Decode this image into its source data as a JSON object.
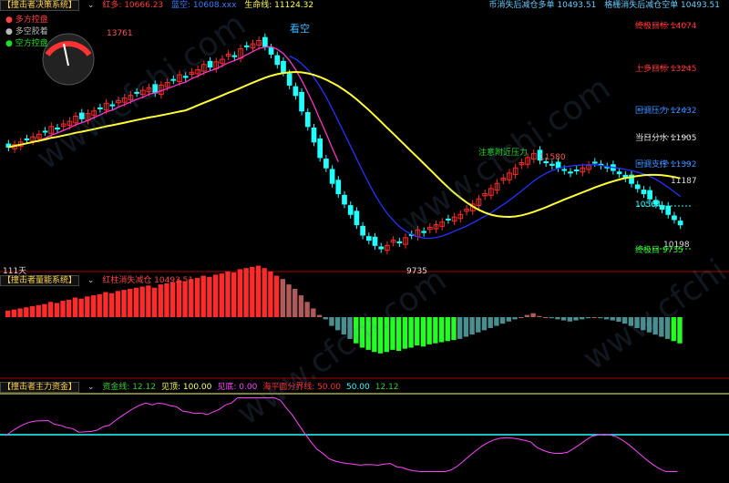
{
  "main_panel": {
    "title": "【撞击者决策系统】",
    "dropdown_icon": "chevron-down-icon",
    "indicators": [
      {
        "label": "红多",
        "value": "10666.23",
        "color": "#ff3b3b"
      },
      {
        "label": "蓝空",
        "value": "10608.xxx",
        "color": "#3b7dff"
      },
      {
        "label": "生命线",
        "value": "11124.32",
        "color": "#ffff55"
      }
    ],
    "top_right": [
      {
        "text": "币消失后减仓多单 10493.51",
        "color": "#66ccff"
      },
      {
        "text": "格栅消失后减仓空单 10493.51",
        "color": "#66ccff"
      }
    ],
    "legend": [
      {
        "text": "多方控盘",
        "color": "#ff4040"
      },
      {
        "text": "多空胶着",
        "color": "#bbbbbb"
      },
      {
        "text": "空方控盘",
        "color": "#22dd22"
      }
    ],
    "annotations": {
      "look_short": "看空",
      "near_resistance": "注意附近压力",
      "high_label": "13761",
      "low_label": "9735",
      "peak_label": "11580",
      "right_label": "11187",
      "last_low_label": "10198",
      "period": "111天"
    },
    "right_levels": [
      {
        "label": "终极目标",
        "value": "14074",
        "color": "#ff3333"
      },
      {
        "label": "上多目标",
        "value": "13245",
        "color": "#ff3333"
      },
      {
        "label": "回调压力",
        "value": "12432",
        "color": "#3a8cff"
      },
      {
        "label": "当日分水",
        "value": "11905",
        "color": "#dddddd"
      },
      {
        "label": "回调支撑",
        "value": "11392",
        "color": "#3a8cff"
      },
      {
        "label": "",
        "value": "10564",
        "color": "#22ffff"
      },
      {
        "label": "终极目",
        "value": "9735",
        "color": "#33ff33"
      }
    ]
  },
  "mid_panel": {
    "title": "【撞击者量能系统】",
    "indicator": "红柱消失减仓 10493.51",
    "indicator_color": "#ff4444"
  },
  "bottom_panel": {
    "title": "【撞击者主力资金】",
    "items": [
      {
        "label": "资金线",
        "value": "12.12",
        "color": "#33cc33"
      },
      {
        "label": "见顶",
        "value": "100.00",
        "color": "#ffff66"
      },
      {
        "label": "见底",
        "value": "0.00",
        "color": "#ff44ff"
      },
      {
        "label": "海平面分界线",
        "value": "50.00",
        "color": "#ff3333"
      },
      {
        "label": "",
        "value": "50.00",
        "color": "#33ffff"
      },
      {
        "label": "",
        "value": "12.12",
        "color": "#33cc33"
      }
    ]
  },
  "watermark": "www.cfchi.com",
  "colors": {
    "bull": "#ff2a2a",
    "bear": "#22ffff",
    "life_line": "#ffff33",
    "pink_ma": "#ff33cc",
    "blue_ma": "#2233ff"
  },
  "chart_data": {
    "type": "candlestick",
    "ylim": [
      9400,
      14300
    ],
    "levels": [
      14074,
      13245,
      12432,
      11905,
      11392,
      10564,
      9735
    ],
    "candles_close_trend": [
      11700,
      11750,
      11800,
      11850,
      11900,
      11950,
      12000,
      12100,
      12050,
      12150,
      12200,
      12300,
      12250,
      12350,
      12400,
      12450,
      12550,
      12500,
      12600,
      12650,
      12700,
      12750,
      12800,
      12850,
      12750,
      12900,
      12950,
      13000,
      13100,
      13050,
      13150,
      13200,
      13300,
      13250,
      13350,
      13400,
      13500,
      13450,
      13600,
      13650,
      13700,
      13761,
      13650,
      13500,
      13300,
      13150,
      12900,
      12700,
      12400,
      12100,
      11800,
      11500,
      11300,
      11000,
      10800,
      10600,
      10400,
      10200,
      10000,
      9900,
      9800,
      9735,
      9800,
      9900,
      9850,
      9950,
      10000,
      10100,
      10050,
      10150,
      10200,
      10250,
      10300,
      10350,
      10400,
      10500,
      10600,
      10700,
      10800,
      10900,
      11000,
      11100,
      11200,
      11300,
      11400,
      11500,
      11580,
      11450,
      11400,
      11350,
      11300,
      11250,
      11200,
      11250,
      11300,
      11350,
      11400,
      11350,
      11300,
      11250,
      11187,
      11100,
      11000,
      10900,
      10800,
      10700,
      10600,
      10500,
      10400,
      10300,
      10198
    ],
    "volume_series": "histogram",
    "fund_line_range": [
      0,
      100
    ]
  }
}
